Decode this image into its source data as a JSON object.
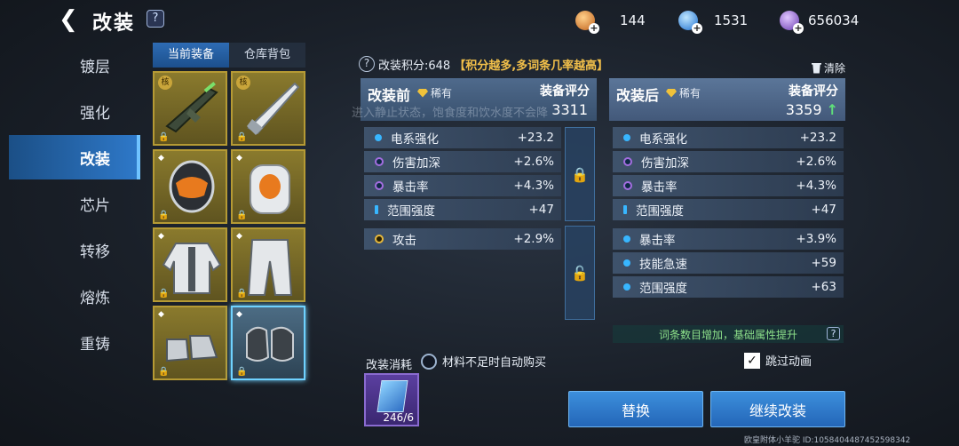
{
  "header": {
    "title": "改装",
    "back_glyph": "❮",
    "help": "?"
  },
  "currency": [
    {
      "icon": "orange-crystal-icon",
      "value": "144",
      "color": "#e08a2a"
    },
    {
      "icon": "blue-crystal-icon",
      "value": "1531",
      "color": "#3aa0ff"
    },
    {
      "icon": "purple-orb-icon",
      "value": "656034",
      "color": "#9a6ad8"
    }
  ],
  "sidebar": {
    "items": [
      {
        "label": "镀层"
      },
      {
        "label": "强化"
      },
      {
        "label": "改装",
        "active": true
      },
      {
        "label": "芯片"
      },
      {
        "label": "转移"
      },
      {
        "label": "熔炼"
      },
      {
        "label": "重铸"
      }
    ]
  },
  "tabs": {
    "current": "当前装备",
    "warehouse": "仓库背包"
  },
  "equipment": {
    "badge_text": "核",
    "gem_glyph": "◆",
    "lock_glyph": "🔒"
  },
  "mod_score": {
    "text": "改装积分:648",
    "hint": "【积分越多,多词条几率越高】",
    "clear": "清除",
    "help": "?"
  },
  "ghost_text": "进入静止状态，饱食度和饮水度不会降",
  "before": {
    "title": "改装前",
    "rarity": "稀有",
    "score_label": "装备评分",
    "score": "3311",
    "stats": [
      {
        "name": "电系强化",
        "value": "+23.2",
        "kind": "dot"
      },
      {
        "name": "伤害加深",
        "value": "+2.6%",
        "kind": "ring"
      },
      {
        "name": "暴击率",
        "value": "+4.3%",
        "kind": "ring"
      },
      {
        "name": "范围强度",
        "value": "+47",
        "kind": "bar"
      },
      {
        "name": "攻击",
        "value": "+2.9%",
        "kind": "gold"
      }
    ]
  },
  "after": {
    "title": "改装后",
    "rarity": "稀有",
    "score_label": "装备评分",
    "score": "3359",
    "arrow": "↑",
    "stats": [
      {
        "name": "电系强化",
        "value": "+23.2",
        "kind": "dot"
      },
      {
        "name": "伤害加深",
        "value": "+2.6%",
        "kind": "ring"
      },
      {
        "name": "暴击率",
        "value": "+4.3%",
        "kind": "ring"
      },
      {
        "name": "范围强度",
        "value": "+47",
        "kind": "bar"
      },
      {
        "name": "暴击率",
        "value": "+3.9%",
        "kind": "dot"
      },
      {
        "name": "技能急速",
        "value": "+59",
        "kind": "dot"
      },
      {
        "name": "范围强度",
        "value": "+63",
        "kind": "dot"
      }
    ]
  },
  "entry_hint": "词条数目增加，基础属性提升",
  "skip_anim": {
    "label": "跳过动画",
    "checked": true
  },
  "cost": {
    "label": "改装消耗",
    "auto_buy": "材料不足时自动购买",
    "material_count": "246/6"
  },
  "buttons": {
    "replace": "替换",
    "continue": "继续改装"
  },
  "footer": "欧皇附体小羊驼  ID:1058404487452598342",
  "lock_glyphs": {
    "locked": "🔒",
    "unlocked": "🔓"
  }
}
